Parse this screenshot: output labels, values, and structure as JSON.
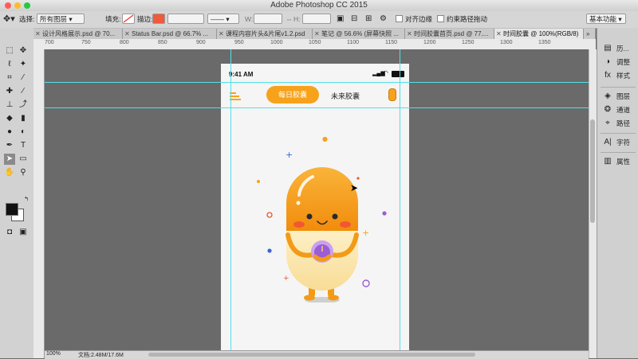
{
  "app_title": "Adobe Photoshop CC 2015",
  "workspace": "基本功能",
  "options": {
    "select_label": "选择:",
    "select_value": "所有图层",
    "fill_label": "填充:",
    "stroke_label": "描边:",
    "w_label": "W:",
    "h_label": "H:",
    "align_edges": "对齐边缘",
    "constrain_path": "约束路径拖动"
  },
  "tabs": [
    {
      "label": "设计风格展示.psd @ 70..."
    },
    {
      "label": "Status Bar.psd @ 66.7% ..."
    },
    {
      "label": "课程内容片头&片尾v1.2.psd"
    },
    {
      "label": "笔记 @ 56.6% (屏幕快照 ..."
    },
    {
      "label": "时间胶囊首页.psd @ 77...."
    },
    {
      "label": "时间胶囊 @ 100%(RGB/8)"
    }
  ],
  "ruler_ticks": [
    "700",
    "750",
    "800",
    "850",
    "900",
    "950",
    "1000",
    "1050",
    "1100",
    "1150",
    "1200",
    "1250",
    "1300",
    "1350"
  ],
  "status": {
    "zoom": "100%",
    "doc": "文档:2.48M/17.6M"
  },
  "panels": [
    "历...",
    "调整",
    "样式",
    "图层",
    "通道",
    "路径",
    "字符",
    "属性"
  ],
  "phone": {
    "time": "9:41 AM",
    "tab_active": "每日胶囊",
    "tab_inactive": "未来胶囊"
  },
  "colors": {
    "accent": "#f7a21b",
    "capsule_top": "#f59a14",
    "capsule_bottom": "#fbe9b8",
    "guide": "#4fe0e6",
    "purple": "#9b5cd6"
  },
  "icons": [
    "move-tool-icon",
    "marquee-icon",
    "lasso-icon",
    "crop-icon",
    "eyedropper-icon",
    "brush-icon",
    "stamp-icon",
    "eraser-icon",
    "gradient-icon",
    "pen-icon",
    "type-icon",
    "path-select-icon",
    "rectangle-icon",
    "hand-icon",
    "zoom-icon"
  ]
}
